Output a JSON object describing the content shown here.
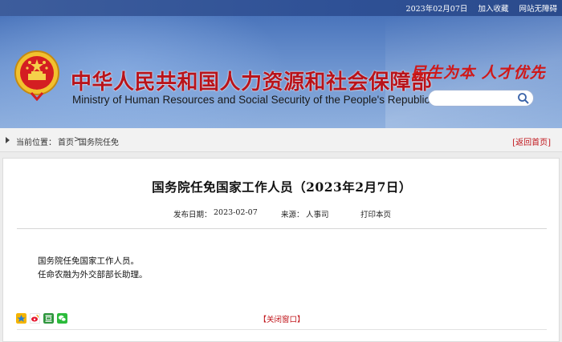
{
  "topbar": {
    "date": "2023年02月07日",
    "favorite": "加入收藏",
    "accessibility": "网站无障碍"
  },
  "header": {
    "title_cn": "中华人民共和国人力资源和社会保障部",
    "title_en": "Ministry of Human Resources and Social Security of the People's Republic of China",
    "slogan": "民生为本 人才优先",
    "search_placeholder": ""
  },
  "breadcrumb": {
    "label": "当前位置：",
    "home": "首页",
    "separator": ">",
    "current": "国务院任免",
    "back": "[返回首页]"
  },
  "article": {
    "title": "国务院任免国家工作人员（2023年2月7日）",
    "date_label": "发布日期：",
    "date": "2023-02-07",
    "source_label": "来源：",
    "source": "人事司",
    "print": "打印本页",
    "lines": [
      "国务院任免国家工作人员。",
      "任命农融为外交部部长助理。"
    ],
    "close": "【关闭窗口】"
  },
  "colors": {
    "brand_red": "#b8141b",
    "banner_blue": "#4a74bb",
    "link_red": "#c0141a"
  }
}
